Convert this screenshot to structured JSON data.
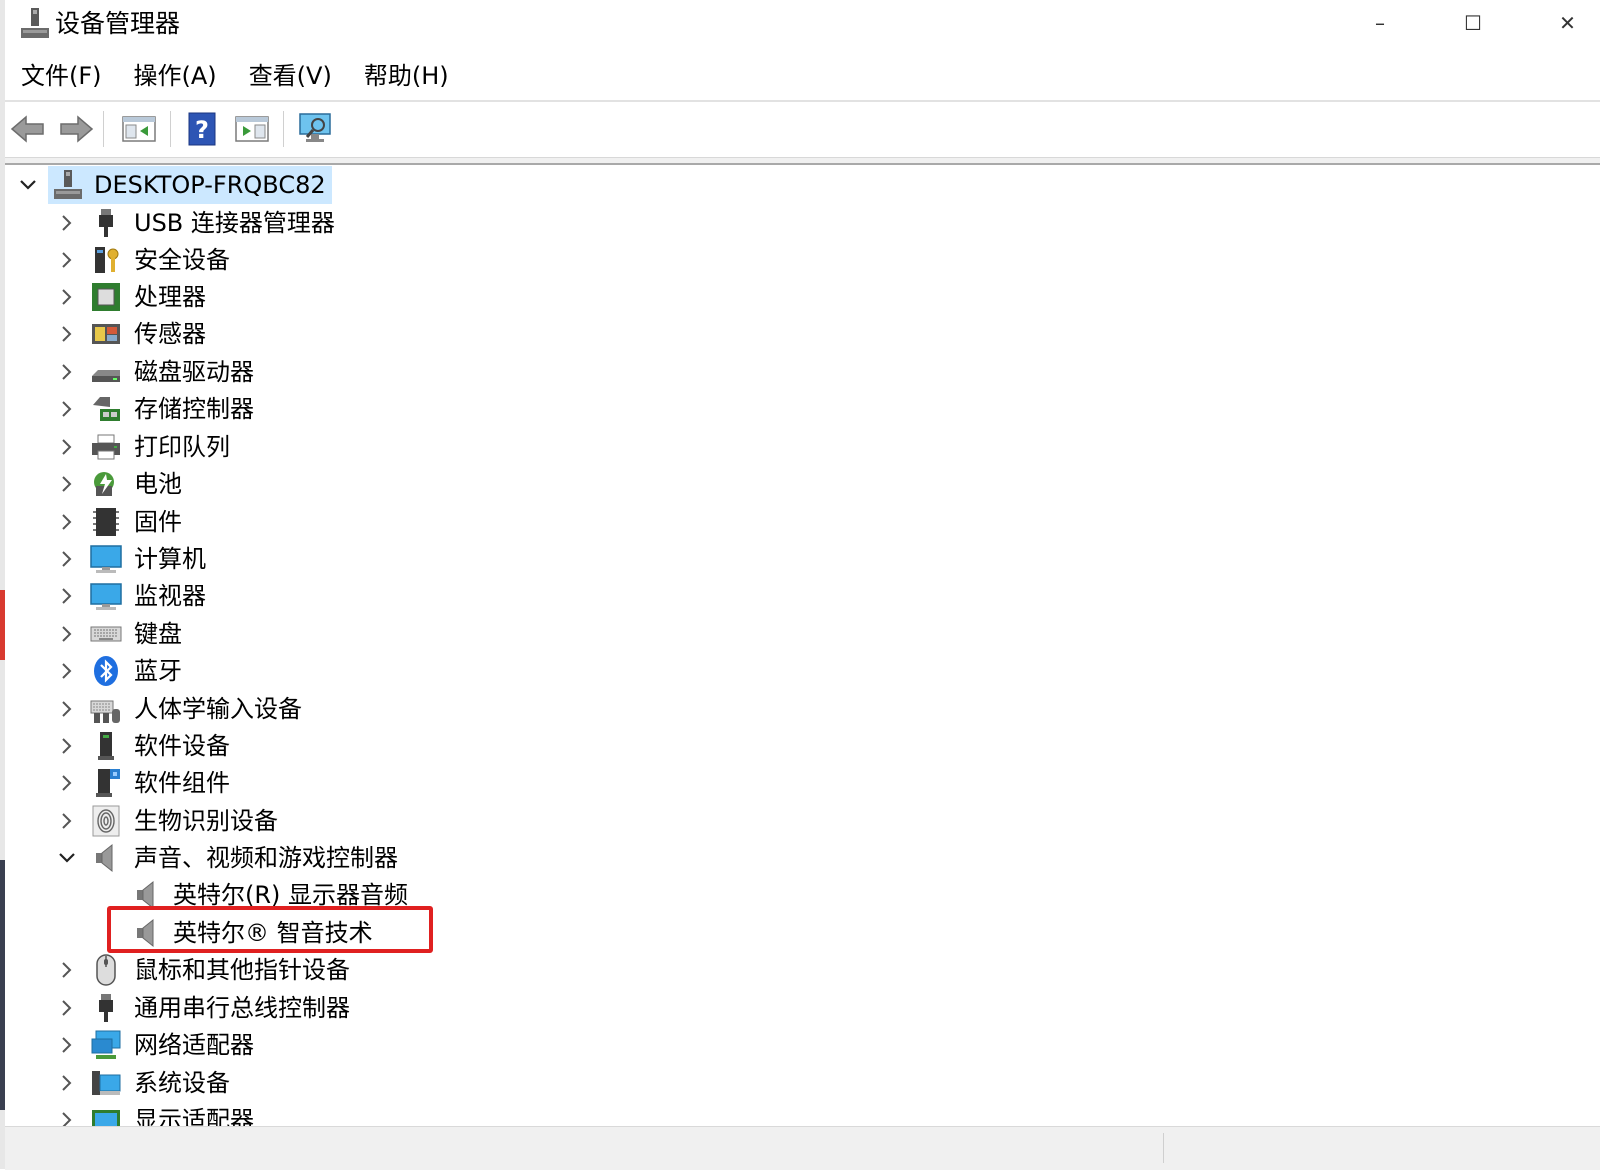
{
  "window": {
    "title": "设备管理器",
    "controls": {
      "minimize": "–",
      "maximize": "☐",
      "close": "✕"
    }
  },
  "menu": [
    {
      "label": "文件(F)"
    },
    {
      "label": "操作(A)"
    },
    {
      "label": "查看(V)"
    },
    {
      "label": "帮助(H)"
    }
  ],
  "toolbar": [
    {
      "icon": "back-arrow-icon"
    },
    {
      "icon": "forward-arrow-icon"
    },
    {
      "icon": "show-hide-console-tree-icon"
    },
    {
      "icon": "help-icon"
    },
    {
      "icon": "properties-icon"
    },
    {
      "icon": "scan-hardware-icon"
    }
  ],
  "tree": {
    "root": {
      "label": "DESKTOP-FRQBC82",
      "expanded": true,
      "selected": true,
      "icon": "computer-tower-icon"
    },
    "categories": [
      {
        "label": "USB 连接器管理器",
        "icon": "usb-connector-icon",
        "expanded": false
      },
      {
        "label": "安全设备",
        "icon": "security-device-icon",
        "expanded": false
      },
      {
        "label": "处理器",
        "icon": "processor-icon",
        "expanded": false
      },
      {
        "label": "传感器",
        "icon": "sensor-icon",
        "expanded": false
      },
      {
        "label": "磁盘驱动器",
        "icon": "disk-drive-icon",
        "expanded": false
      },
      {
        "label": "存储控制器",
        "icon": "storage-controller-icon",
        "expanded": false
      },
      {
        "label": "打印队列",
        "icon": "printer-icon",
        "expanded": false
      },
      {
        "label": "电池",
        "icon": "battery-icon",
        "expanded": false
      },
      {
        "label": "固件",
        "icon": "firmware-icon",
        "expanded": false
      },
      {
        "label": "计算机",
        "icon": "computer-monitor-icon",
        "expanded": false
      },
      {
        "label": "监视器",
        "icon": "monitor-icon",
        "expanded": false
      },
      {
        "label": "键盘",
        "icon": "keyboard-icon",
        "expanded": false
      },
      {
        "label": "蓝牙",
        "icon": "bluetooth-icon",
        "expanded": false
      },
      {
        "label": "人体学输入设备",
        "icon": "hid-icon",
        "expanded": false
      },
      {
        "label": "软件设备",
        "icon": "software-device-icon",
        "expanded": false
      },
      {
        "label": "软件组件",
        "icon": "software-component-icon",
        "expanded": false
      },
      {
        "label": "生物识别设备",
        "icon": "fingerprint-icon",
        "expanded": false
      },
      {
        "label": "声音、视频和游戏控制器",
        "icon": "speaker-icon",
        "expanded": true,
        "children": [
          {
            "label": "英特尔(R) 显示器音频",
            "icon": "speaker-icon"
          },
          {
            "label": "英特尔® 智音技术",
            "icon": "speaker-icon",
            "highlighted": true
          }
        ]
      },
      {
        "label": "鼠标和其他指针设备",
        "icon": "mouse-icon",
        "expanded": false
      },
      {
        "label": "通用串行总线控制器",
        "icon": "usb-controller-icon",
        "expanded": false
      },
      {
        "label": "网络适配器",
        "icon": "network-adapter-icon",
        "expanded": false
      },
      {
        "label": "系统设备",
        "icon": "system-device-icon",
        "expanded": false
      },
      {
        "label": "显示适配器",
        "icon": "display-adapter-icon",
        "expanded": false
      }
    ]
  }
}
